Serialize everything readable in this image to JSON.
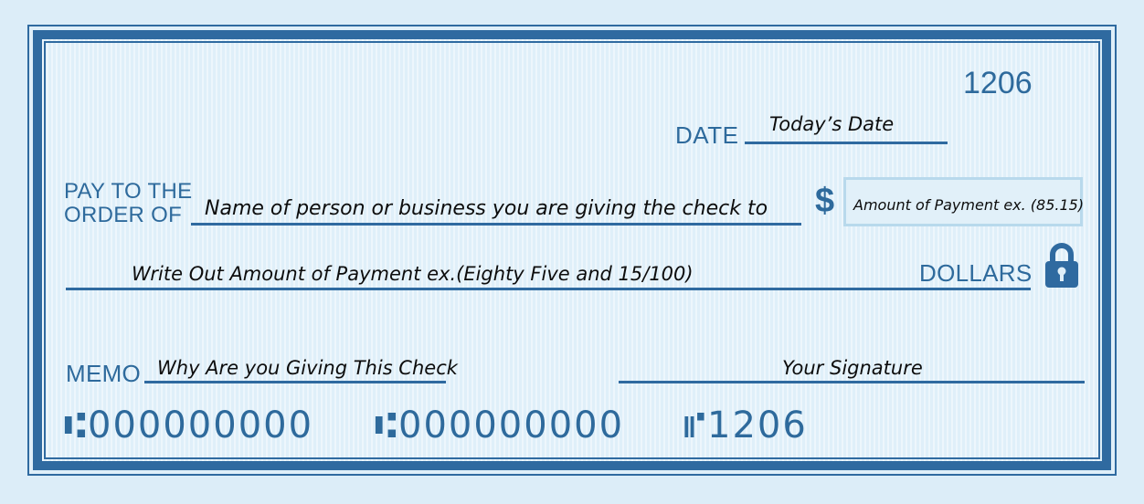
{
  "check": {
    "number": "1206",
    "date_label": "DATE",
    "date_value": "Today’s Date",
    "payto_label_line1": "PAY TO THE",
    "payto_label_line2": "ORDER OF",
    "payee_value": "Name of person or business you are giving the check to",
    "dollar_sign": "$",
    "amount_value": "Amount of Payment ex. (85.15)",
    "amount_words_value": "Write Out Amount of Payment ex.(Eighty Five and 15/100)",
    "dollars_label": "DOLLARS",
    "memo_label": "MEMO",
    "memo_value": "Why Are you Giving This Check",
    "signature_value": "Your Signature",
    "micr_routing": "⑆000000000",
    "micr_account": "⑆000000000",
    "micr_check": "⑈1206"
  },
  "icons": {
    "security": "lock-icon"
  },
  "colors": {
    "ink_blue": "#2e6a9c",
    "background": "#dfeff9",
    "handwriting": "#0d0d0d"
  }
}
